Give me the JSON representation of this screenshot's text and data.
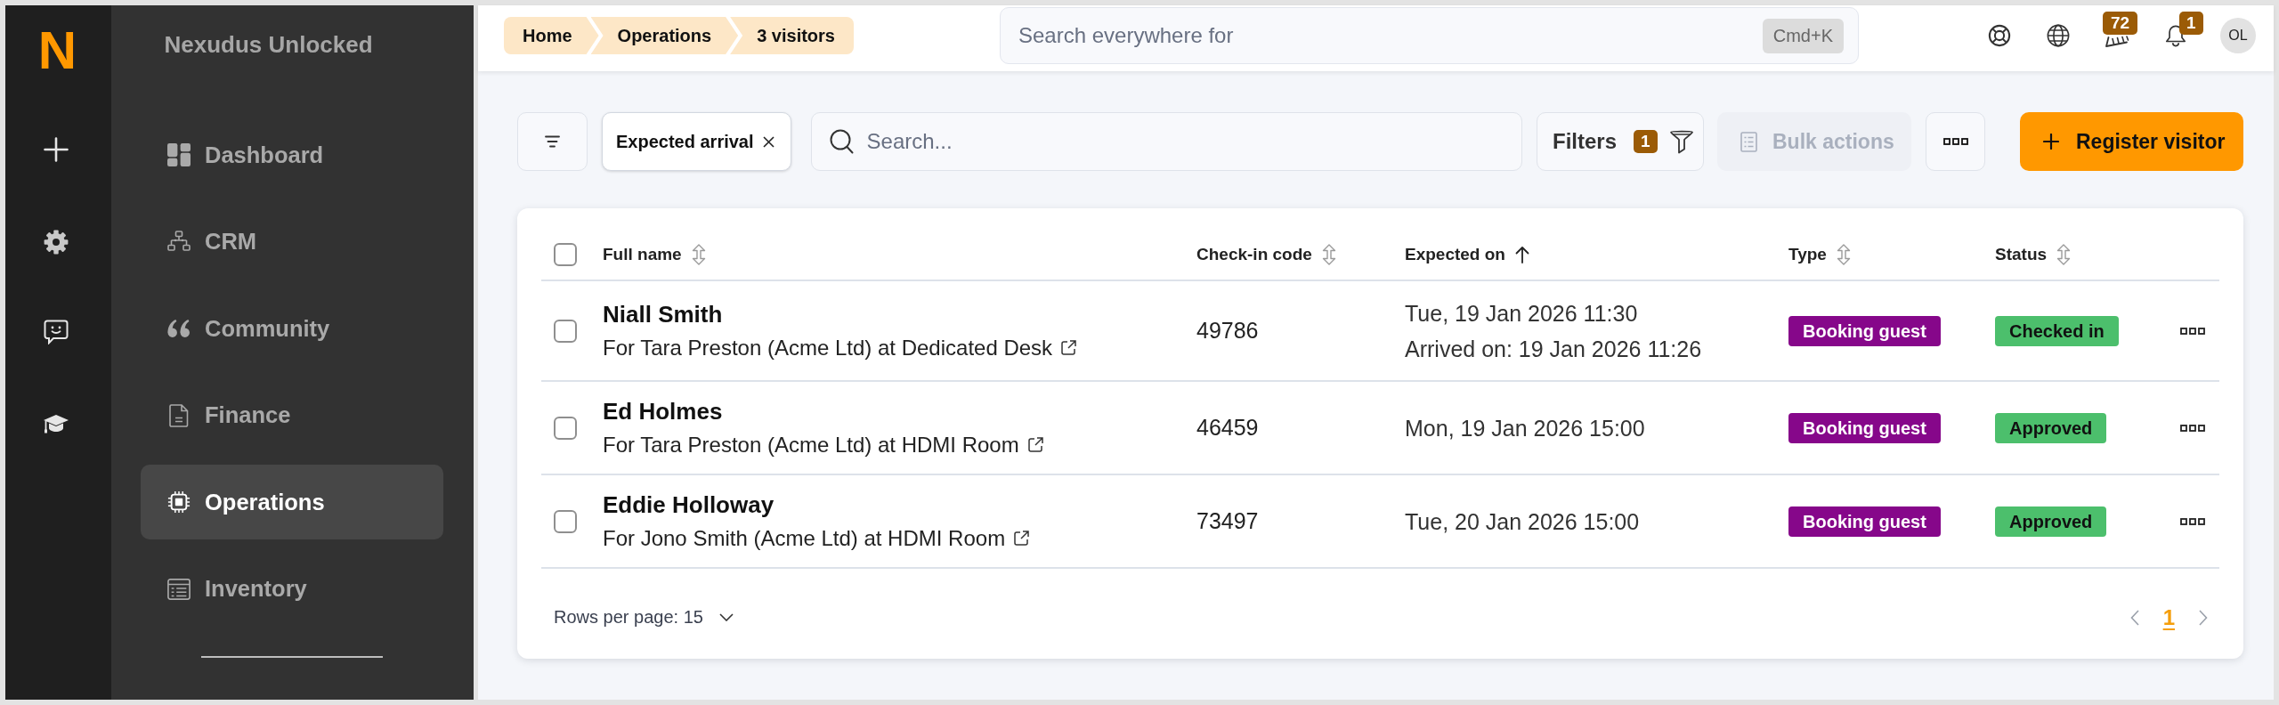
{
  "rail": {
    "logo": "N"
  },
  "sidebar": {
    "title": "Nexudus Unlocked",
    "items": [
      {
        "label": "Dashboard",
        "selected": false
      },
      {
        "label": "CRM",
        "selected": false
      },
      {
        "label": "Community",
        "selected": false
      },
      {
        "label": "Finance",
        "selected": false
      },
      {
        "label": "Operations",
        "selected": true
      },
      {
        "label": "Inventory",
        "selected": false
      }
    ]
  },
  "topbar": {
    "breadcrumbs": [
      "Home",
      "Operations",
      "3 visitors"
    ],
    "search": {
      "placeholder": "Search everywhere for",
      "shortcut": "Cmd+K"
    },
    "announcements_badge": "72",
    "notifications_badge": "1",
    "avatar_initials": "OL"
  },
  "toolbar": {
    "active_filter": "Expected arrival",
    "search": {
      "placeholder": "Search..."
    },
    "filters": {
      "label": "Filters",
      "count": "1"
    },
    "bulk_actions": {
      "label": "Bulk actions",
      "disabled": true
    },
    "register_button": {
      "label": "Register visitor"
    }
  },
  "table": {
    "header_checked": false,
    "columns": [
      {
        "label": "Full name",
        "sorted": false
      },
      {
        "label": "Check-in code",
        "sorted": false
      },
      {
        "label": "Expected on",
        "sorted": true
      },
      {
        "label": "Type",
        "sorted": false
      },
      {
        "label": "Status",
        "sorted": false
      }
    ],
    "rows": [
      {
        "checked": false,
        "name": "Niall Smith",
        "detail": "For Tara Preston (Acme Ltd) at Dedicated Desk",
        "code": "49786",
        "expected": "Tue, 19 Jan 2026 11:30",
        "arrived": "Arrived on: 19 Jan 2026 11:26",
        "type": "Booking guest",
        "status": "Checked in"
      },
      {
        "checked": false,
        "name": "Ed Holmes",
        "detail": "For Tara Preston (Acme Ltd) at HDMI Room",
        "code": "46459",
        "expected": "Mon, 19 Jan 2026 15:00",
        "type": "Booking guest",
        "status": "Approved"
      },
      {
        "checked": false,
        "name": "Eddie Holloway",
        "detail": "For Jono Smith (Acme Ltd) at HDMI Room",
        "code": "73497",
        "expected": "Tue, 20 Jan 2026 15:00",
        "type": "Booking guest",
        "status": "Approved"
      }
    ]
  },
  "pagination": {
    "rows_per_page": "Rows per page: 15",
    "pages": [
      {
        "label": "1",
        "selected": true
      }
    ]
  }
}
